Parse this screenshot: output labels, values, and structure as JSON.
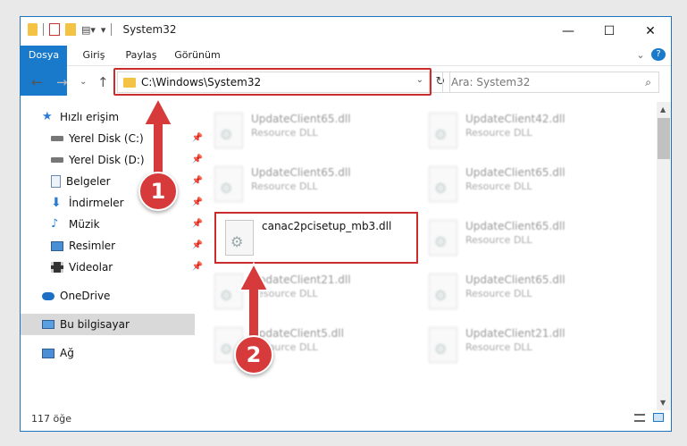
{
  "titlebar": {
    "title": "System32",
    "minimize": "—",
    "maximize": "☐",
    "close": "✕"
  },
  "ribbon": {
    "tabs": [
      {
        "label": "Dosya"
      },
      {
        "label": "Giriş"
      },
      {
        "label": "Paylaş"
      },
      {
        "label": "Görünüm"
      }
    ],
    "expand": "⌄",
    "help": "?"
  },
  "nav": {
    "back": "←",
    "forward": "→",
    "recent": "⌄",
    "up": "↑"
  },
  "address": {
    "path": "C:\\Windows\\System32",
    "dropdown": "⌄",
    "refresh": "↻"
  },
  "search": {
    "placeholder": "Ara: System32",
    "icon": "⌕"
  },
  "sidebar": {
    "items": [
      {
        "label": "Hızlı erişim",
        "icon": "star-icon"
      },
      {
        "label": "Yerel Disk (C:)",
        "icon": "drive-icon"
      },
      {
        "label": "Yerel Disk (D:)",
        "icon": "drive-icon"
      },
      {
        "label": "Belgeler",
        "icon": "documents-icon"
      },
      {
        "label": "İndirmeler",
        "icon": "download-icon"
      },
      {
        "label": "Müzik",
        "icon": "music-icon"
      },
      {
        "label": "Resimler",
        "icon": "pictures-icon"
      },
      {
        "label": "Videolar",
        "icon": "video-icon"
      },
      {
        "label": "OneDrive",
        "icon": "cloud-icon"
      },
      {
        "label": "Bu bilgisayar",
        "icon": "computer-icon"
      },
      {
        "label": "Ağ",
        "icon": "network-icon"
      }
    ],
    "pin": "📌"
  },
  "files": [
    {
      "name": "UpdateClient65.dll",
      "type": "Resource DLL"
    },
    {
      "name": "UpdateClient42.dll",
      "type": "Resource DLL"
    },
    {
      "name": "UpdateClient65.dll",
      "type": "Resource DLL"
    },
    {
      "name": "UpdateClient65.dll",
      "type": "Resource DLL"
    },
    {
      "name": "canac2pcisetup_mb3.dll",
      "type": ""
    },
    {
      "name": "UpdateClient65.dll",
      "type": "Resource DLL"
    },
    {
      "name": "UpdateClient21.dll",
      "type": "Resource DLL"
    },
    {
      "name": "UpdateClient65.dll",
      "type": "Resource DLL"
    },
    {
      "name": "UpdateClient5.dll",
      "type": "Resource DLL"
    },
    {
      "name": "UpdateClient21.dll",
      "type": "Resource DLL"
    }
  ],
  "status": {
    "count": "117 öğe"
  },
  "annotations": {
    "step1": "1",
    "step2": "2",
    "color": "#d63a3a"
  }
}
